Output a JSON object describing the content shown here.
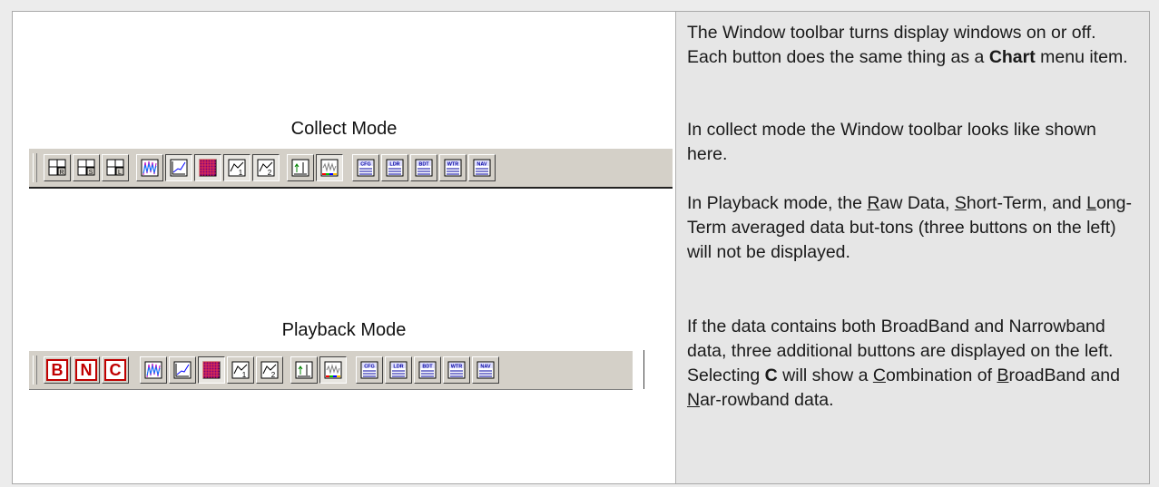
{
  "collect_label": "Collect Mode",
  "playback_label": "Playback Mode",
  "collect_toolbar": [
    {
      "name": "raw-data-icon",
      "sub": "R"
    },
    {
      "name": "short-term-icon",
      "sub": "S"
    },
    {
      "name": "long-term-icon",
      "sub": "L"
    },
    {
      "name": "spectrum-icon"
    },
    {
      "name": "line-chart-icon",
      "pressed": true
    },
    {
      "name": "grid-chart-icon",
      "pressed": true
    },
    {
      "name": "chart1-icon",
      "sub": "1",
      "pressed": true
    },
    {
      "name": "chart2-icon",
      "sub": "2",
      "pressed": true
    },
    {
      "name": "up-chart-icon"
    },
    {
      "name": "waveform-icon",
      "pressed": true
    },
    {
      "name": "cfg-icon",
      "text": "CFG"
    },
    {
      "name": "ldr-icon",
      "text": "LDR"
    },
    {
      "name": "bdt-icon",
      "text": "BDT"
    },
    {
      "name": "wtr-icon",
      "text": "WTR"
    },
    {
      "name": "nav-icon",
      "text": "NAV"
    }
  ],
  "playback_letters": [
    "B",
    "N",
    "C"
  ],
  "paragraphs": {
    "p1a": "The Window toolbar turns display windows on or off. Each button does the same thing as a ",
    "p1b": "Chart",
    "p1c": " menu item.",
    "p2": "In collect mode the Window toolbar looks like shown here.",
    "p3": [
      "In Playback mode, the ",
      "R",
      "aw Data, ",
      "S",
      "hort-Term, and ",
      "L",
      "ong-Term averaged data but-tons (three buttons on the left) will not be displayed."
    ],
    "p4": [
      "If the data contains both BroadBand and Narrowband data, three additional buttons are displayed on the left. Selecting ",
      "C",
      " will show a ",
      "C",
      "ombination of ",
      "B",
      "roadBand and ",
      "N",
      "ar-rowband data."
    ]
  }
}
